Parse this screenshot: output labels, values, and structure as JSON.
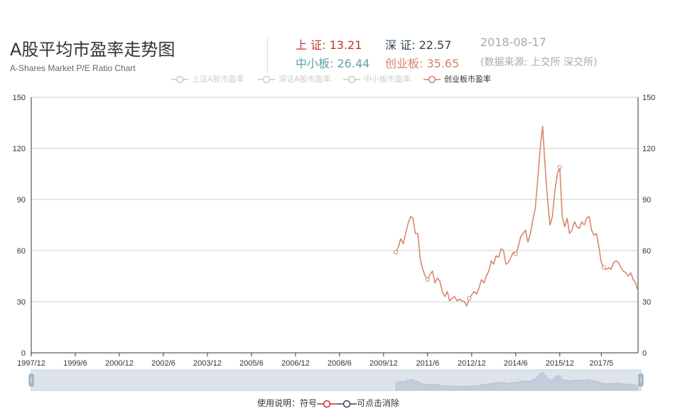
{
  "header": {
    "title": "A股平均市盈率走势图",
    "subtitle": "A-Shares Market P/E Ratio Chart",
    "date": "2018-08-17",
    "source": "(数据来源: 上交所 深交所)"
  },
  "stats": [
    {
      "label": "上 证",
      "value": "13.21",
      "color": "#c23531"
    },
    {
      "label": "深 证",
      "value": "22.57",
      "color": "#2f4554"
    },
    {
      "label": "中小板",
      "value": "26.44",
      "color": "#61a0a8"
    },
    {
      "label": "创业板",
      "value": "35.65",
      "color": "#d48265"
    }
  ],
  "legend": [
    {
      "name": "上证A股市盈率",
      "active": false
    },
    {
      "name": "深证A股市盈率",
      "active": false
    },
    {
      "name": "中小板市盈率",
      "active": false
    },
    {
      "name": "创业板市盈率",
      "active": true
    }
  ],
  "note": {
    "prefix": "使用说明：符号",
    "suffix": "可点击消除"
  },
  "colors": {
    "accent": "#d48265",
    "inactive": "#cccccc",
    "grid": "#cccccc",
    "axis": "#333333"
  },
  "chart_data": {
    "type": "line",
    "title": "A股平均市盈率走势图",
    "subtitle": "A-Shares Market P/E Ratio Chart",
    "ylim": [
      0,
      150
    ],
    "y_ticks": [
      0,
      30,
      60,
      90,
      120,
      150
    ],
    "x_tick_labels": [
      "1997/12",
      "1999/6",
      "2000/12",
      "2002/6",
      "2003/12",
      "2005/6",
      "2006/12",
      "2008/6",
      "2009/12",
      "2011/6",
      "2012/12",
      "2014/6",
      "2015/12",
      "2017/5"
    ],
    "x_range": [
      "1997-12",
      "2018-08"
    ],
    "grid": true,
    "legend_position": "top-center",
    "series": [
      {
        "name": "上证A股市盈率",
        "visible": false,
        "points": []
      },
      {
        "name": "深证A股市盈率",
        "visible": false,
        "points": []
      },
      {
        "name": "中小板市盈率",
        "visible": false,
        "points": []
      },
      {
        "name": "创业板市盈率",
        "visible": true,
        "color": "#d48265",
        "points": [
          [
            "2010-05",
            59
          ],
          [
            "2010-06",
            62
          ],
          [
            "2010-07",
            67
          ],
          [
            "2010-08",
            64
          ],
          [
            "2010-09",
            70
          ],
          [
            "2010-10",
            76
          ],
          [
            "2010-11",
            80
          ],
          [
            "2010-12",
            79
          ],
          [
            "2011-01",
            70
          ],
          [
            "2011-02",
            70
          ],
          [
            "2011-03",
            55
          ],
          [
            "2011-04",
            49
          ],
          [
            "2011-05",
            45
          ],
          [
            "2011-06",
            43
          ],
          [
            "2011-07",
            46
          ],
          [
            "2011-08",
            48
          ],
          [
            "2011-09",
            41
          ],
          [
            "2011-10",
            44
          ],
          [
            "2011-11",
            42
          ],
          [
            "2011-12",
            36
          ],
          [
            "2012-01",
            33
          ],
          [
            "2012-02",
            36
          ],
          [
            "2012-03",
            30.5
          ],
          [
            "2012-04",
            32
          ],
          [
            "2012-05",
            33
          ],
          [
            "2012-06",
            30.5
          ],
          [
            "2012-07",
            31.5
          ],
          [
            "2012-08",
            30.5
          ],
          [
            "2012-09",
            30
          ],
          [
            "2012-10",
            27.5
          ],
          [
            "2012-11",
            32
          ],
          [
            "2012-12",
            34
          ],
          [
            "2013-01",
            36
          ],
          [
            "2013-02",
            34.5
          ],
          [
            "2013-03",
            38
          ],
          [
            "2013-04",
            43
          ],
          [
            "2013-05",
            41
          ],
          [
            "2013-06",
            45
          ],
          [
            "2013-07",
            48
          ],
          [
            "2013-08",
            54
          ],
          [
            "2013-09",
            52
          ],
          [
            "2013-10",
            57
          ],
          [
            "2013-11",
            56
          ],
          [
            "2013-12",
            61
          ],
          [
            "2014-01",
            60
          ],
          [
            "2014-02",
            52
          ],
          [
            "2014-03",
            53
          ],
          [
            "2014-04",
            56
          ],
          [
            "2014-05",
            59
          ],
          [
            "2014-06",
            58
          ],
          [
            "2014-07",
            62
          ],
          [
            "2014-08",
            68
          ],
          [
            "2014-09",
            70
          ],
          [
            "2014-10",
            72
          ],
          [
            "2014-11",
            65
          ],
          [
            "2014-12",
            70
          ],
          [
            "2015-01",
            78
          ],
          [
            "2015-02",
            85
          ],
          [
            "2015-03",
            102
          ],
          [
            "2015-04",
            120
          ],
          [
            "2015-05",
            133
          ],
          [
            "2015-06",
            110
          ],
          [
            "2015-07",
            90
          ],
          [
            "2015-08",
            75
          ],
          [
            "2015-09",
            80
          ],
          [
            "2015-10",
            95
          ],
          [
            "2015-11",
            105
          ],
          [
            "2015-12",
            109
          ],
          [
            "2016-01",
            80
          ],
          [
            "2016-02",
            74
          ],
          [
            "2016-03",
            79
          ],
          [
            "2016-04",
            70
          ],
          [
            "2016-05",
            72
          ],
          [
            "2016-06",
            77
          ],
          [
            "2016-07",
            74
          ],
          [
            "2016-08",
            73
          ],
          [
            "2016-09",
            77
          ],
          [
            "2016-10",
            75
          ],
          [
            "2016-11",
            79
          ],
          [
            "2016-12",
            80
          ],
          [
            "2017-01",
            72
          ],
          [
            "2017-02",
            69
          ],
          [
            "2017-03",
            70
          ],
          [
            "2017-04",
            62
          ],
          [
            "2017-05",
            53
          ],
          [
            "2017-06",
            50
          ],
          [
            "2017-07",
            49
          ],
          [
            "2017-08",
            50
          ],
          [
            "2017-09",
            49
          ],
          [
            "2017-10",
            53
          ],
          [
            "2017-11",
            54
          ],
          [
            "2017-12",
            53
          ],
          [
            "2018-01",
            50
          ],
          [
            "2018-02",
            48
          ],
          [
            "2018-03",
            47
          ],
          [
            "2018-04",
            45
          ],
          [
            "2018-05",
            47
          ],
          [
            "2018-06",
            43
          ],
          [
            "2018-07",
            41
          ],
          [
            "2018-08",
            36
          ]
        ]
      }
    ]
  }
}
